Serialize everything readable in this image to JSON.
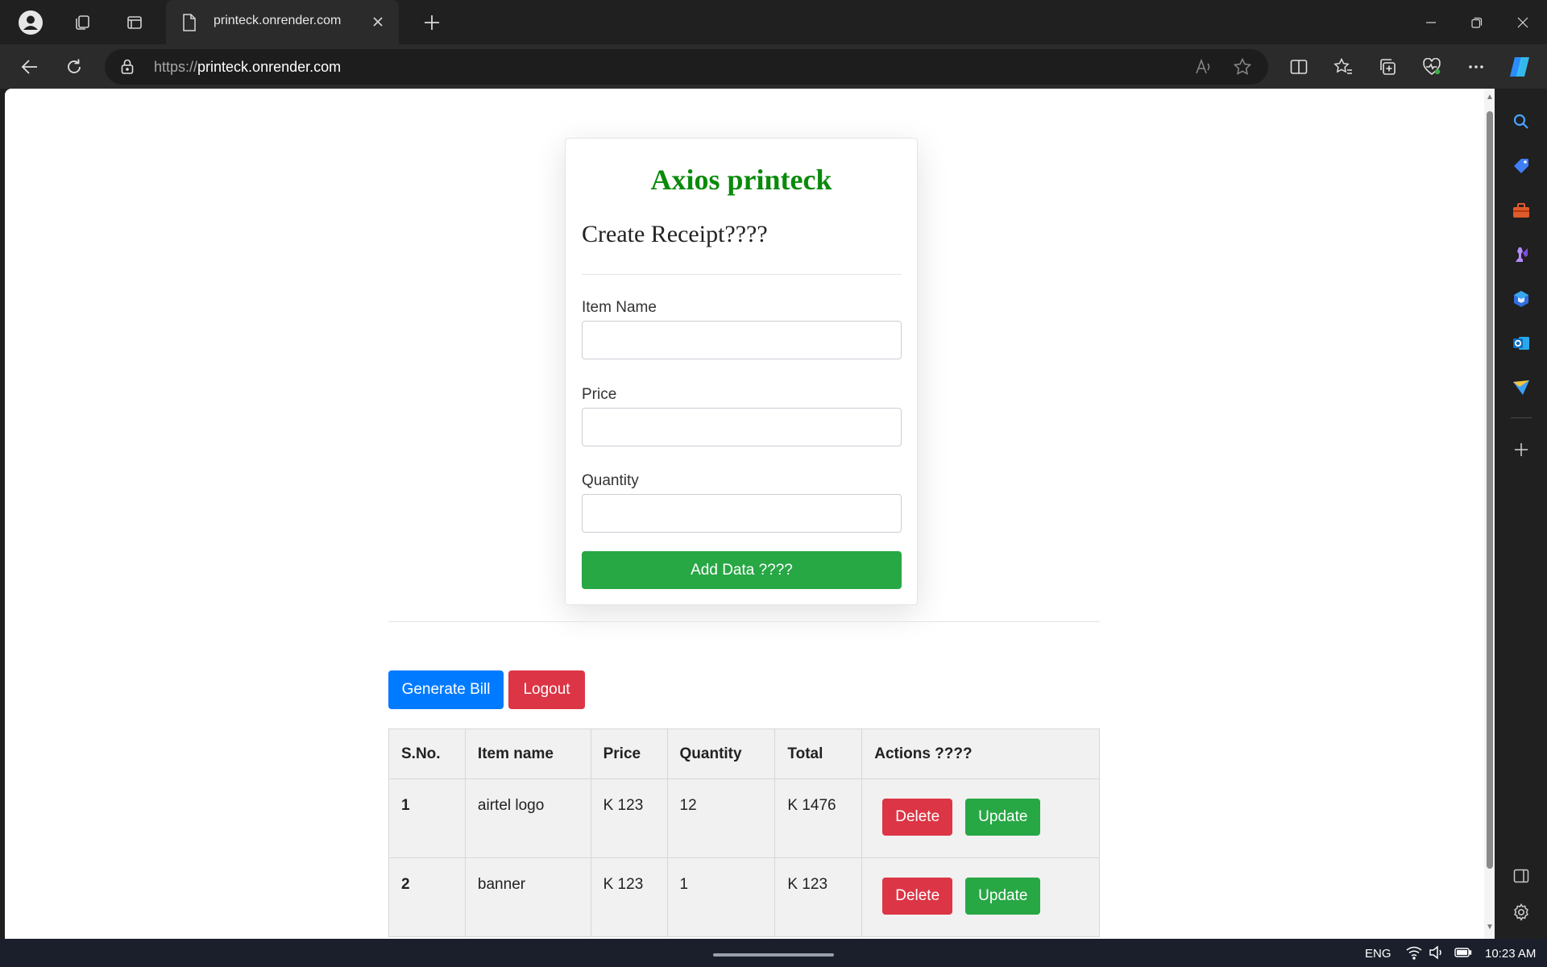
{
  "browser": {
    "tab_title": "printeck.onrender.com",
    "url_protocol": "https://",
    "url_host": "printeck.onrender.com"
  },
  "page": {
    "brand": "Axios printeck",
    "form_title": "Create Receipt????",
    "fields": [
      {
        "label": "Item Name",
        "value": ""
      },
      {
        "label": "Price",
        "value": ""
      },
      {
        "label": "Quantity",
        "value": ""
      }
    ],
    "add_button": "Add Data ????",
    "generate_button": "Generate Bill",
    "logout_button": "Logout",
    "table": {
      "headers": [
        "S.No.",
        "Item name",
        "Price",
        "Quantity",
        "Total",
        "Actions ????"
      ],
      "rows": [
        {
          "sno": "1",
          "item": "airtel logo",
          "price": "K 123",
          "qty": "12",
          "total": "K 1476",
          "delete": "Delete",
          "update": "Update"
        },
        {
          "sno": "2",
          "item": "banner",
          "price": "K 123",
          "qty": "1",
          "total": "K 123",
          "delete": "Delete",
          "update": "Update"
        }
      ]
    }
  },
  "taskbar": {
    "language": "ENG",
    "time": "10:23 AM"
  },
  "colors": {
    "brand_green": "#0a8a0a",
    "primary": "#007bff",
    "success": "#28a745",
    "danger": "#dc3545"
  },
  "icons": {
    "tabbar": [
      "profile-icon",
      "workspaces-icon",
      "tab-actions-icon",
      "page-icon",
      "close-icon",
      "new-tab-icon"
    ],
    "toolbar": [
      "back-icon",
      "refresh-icon",
      "lock-icon",
      "read-aloud-icon",
      "favorite-star-icon",
      "split-screen-icon",
      "favorites-icon",
      "collections-icon",
      "browser-essentials-icon",
      "more-icon",
      "copilot-icon"
    ],
    "sidebar": [
      "search-icon",
      "shopping-tag-icon",
      "tools-icon",
      "games-icon",
      "microsoft365-icon",
      "outlook-icon",
      "drop-icon",
      "add-icon",
      "hide-sidebar-icon",
      "settings-icon"
    ]
  }
}
